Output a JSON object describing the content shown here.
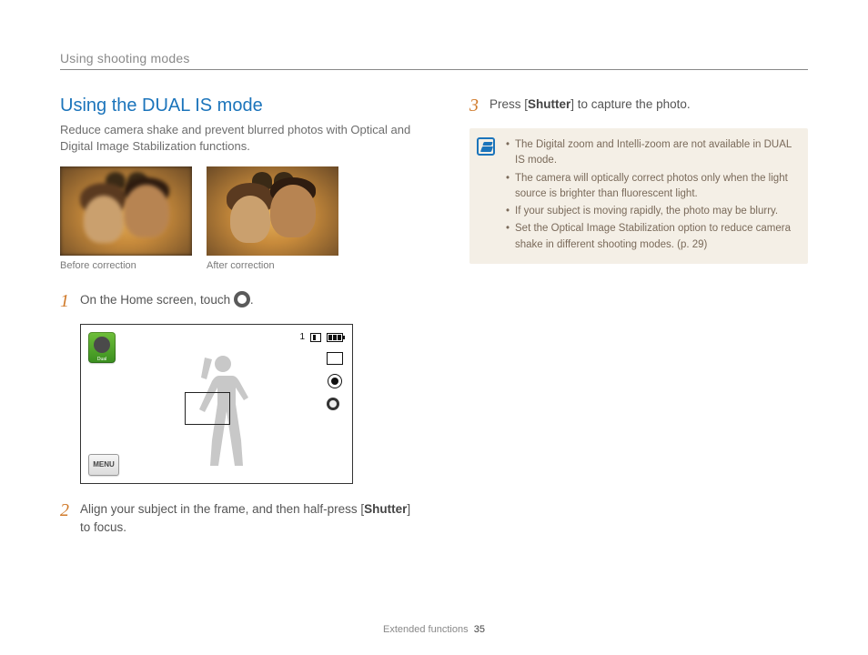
{
  "header": {
    "breadcrumb": "Using shooting modes"
  },
  "section": {
    "title": "Using the DUAL IS mode",
    "intro": "Reduce camera shake and prevent blurred photos with Optical and Digital Image Stabilization functions."
  },
  "compare": {
    "before_caption": "Before correction",
    "after_caption": "After correction"
  },
  "steps": [
    {
      "num": "1",
      "text_before": "On the Home screen, touch ",
      "text_after": "."
    },
    {
      "num": "2",
      "text_before": "Align your subject in the frame, and then half-press [",
      "bold": "Shutter",
      "text_after": "] to focus."
    },
    {
      "num": "3",
      "text_before": "Press [",
      "bold": "Shutter",
      "text_after": "] to capture the photo."
    }
  ],
  "camera_screen": {
    "mode_label": "Dual",
    "menu_label": "MENU",
    "shots_remaining": "1"
  },
  "notes": [
    "The Digital zoom and Intelli-zoom are not available in DUAL IS mode.",
    "The camera will optically correct photos only when the light source is brighter than fluorescent light.",
    "If your subject is moving rapidly, the photo may be blurry.",
    "Set the Optical Image Stabilization option to reduce camera shake in different shooting modes. (p. 29)"
  ],
  "footer": {
    "section": "Extended functions",
    "page": "35"
  }
}
